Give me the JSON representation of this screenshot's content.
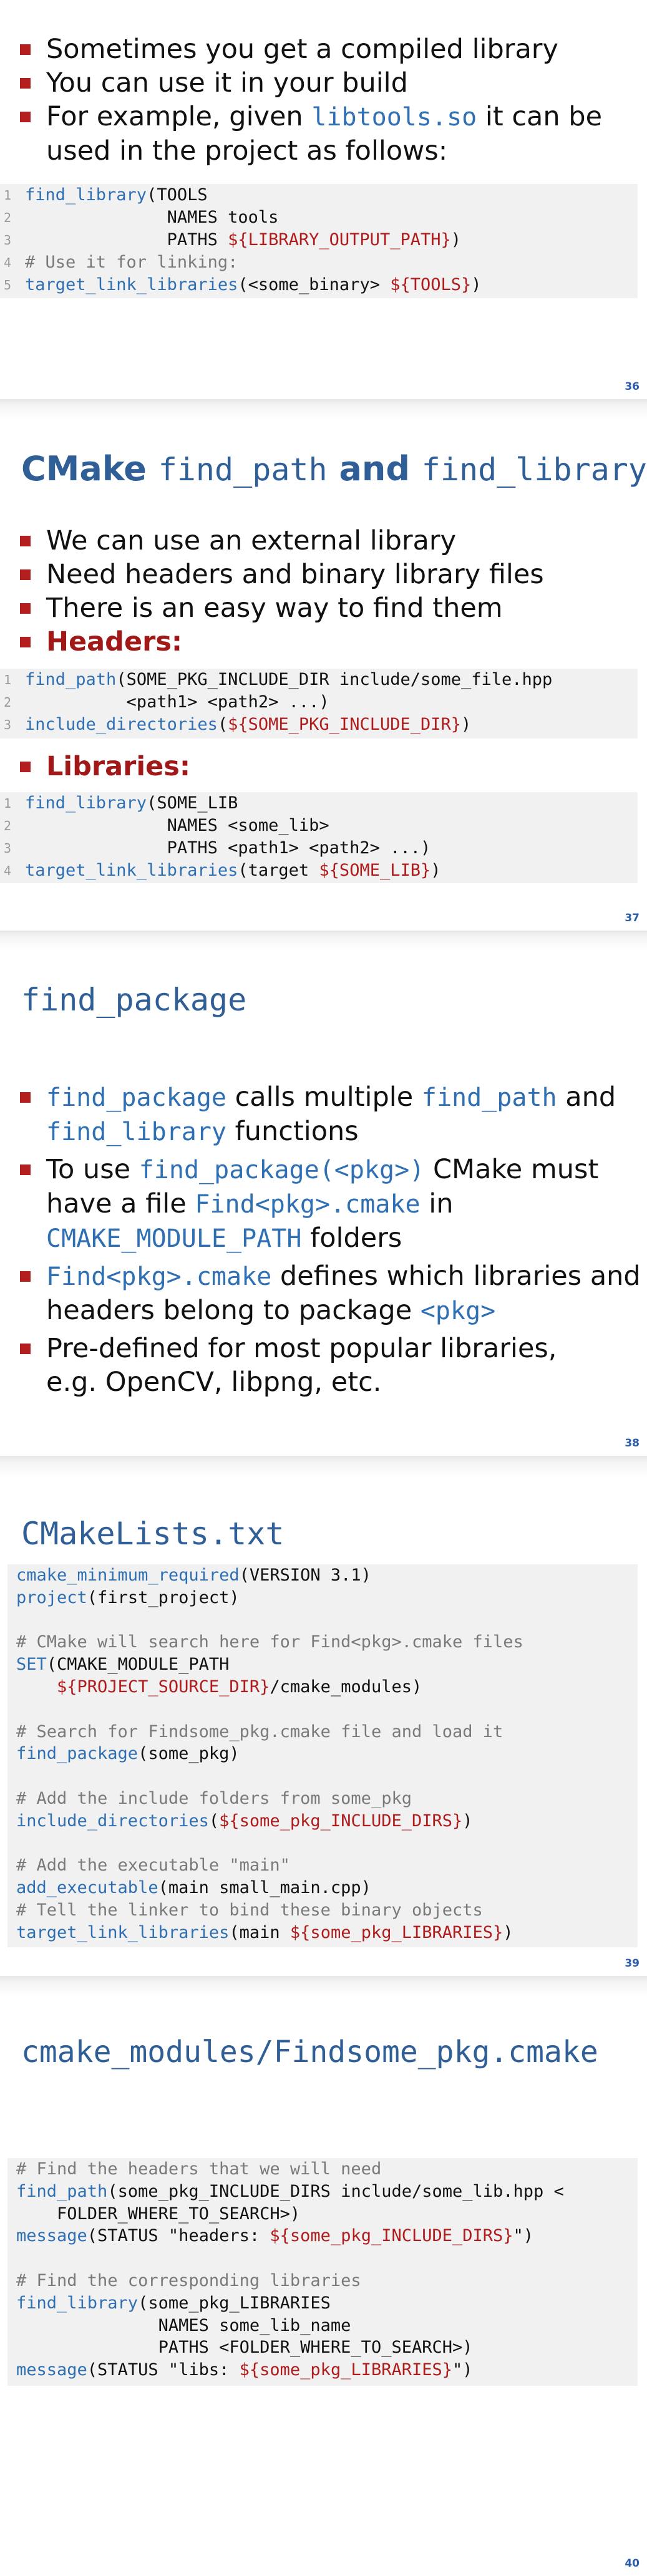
{
  "slide36": {
    "bullets": [
      "Sometimes you get a compiled library",
      "You can use it in your build"
    ],
    "bullet3_before": "For example, given ",
    "bullet3_code": "libtools.so",
    "bullet3_after": " it can be",
    "bullet3_line2": "used in the project as follows:",
    "code": {
      "l1_fn": "find_library",
      "l1_rest": "(TOOLS",
      "l2": "              NAMES tools",
      "l3_pre": "              PATHS ",
      "l3_var": "${LIBRARY_OUTPUT_PATH}",
      "l3_post": ")",
      "l4": "# Use it for linking:",
      "l5_fn": "target_link_libraries",
      "l5_rest": "(<some_binary> ",
      "l5_var": "${TOOLS}",
      "l5_post": ")"
    },
    "page_number": "36"
  },
  "slide37": {
    "title_prefix": "CMake ",
    "title_code1": "find_path",
    "title_mid": " and ",
    "title_code2": "find_library",
    "bullets": [
      "We can use an external library",
      "Need headers and binary library files",
      "There is an easy way to find them"
    ],
    "headers_label": "Headers:",
    "code1": {
      "l1_fn": "find_path",
      "l1_rest": "(SOME_PKG_INCLUDE_DIR include/some_file.hpp",
      "l2": "          <path1> <path2> ...)",
      "l3_fn": "include_directories",
      "l3_pre": "(",
      "l3_var": "${SOME_PKG_INCLUDE_DIR}",
      "l3_post": ")"
    },
    "libraries_label": "Libraries:",
    "code2": {
      "l1_fn": "find_library",
      "l1_rest": "(SOME_LIB",
      "l2": "              NAMES <some_lib>",
      "l3": "              PATHS <path1> <path2> ...)",
      "l4_fn": "target_link_libraries",
      "l4_rest": "(target ",
      "l4_var": "${SOME_LIB}",
      "l4_post": ")"
    },
    "page_number": "37"
  },
  "slide38": {
    "title": "find_package",
    "b1_code1": "find_package",
    "b1_text1": " calls multiple ",
    "b1_code2": "find_path",
    "b1_text2": " and",
    "b1_code3": "find_library",
    "b1_text3": " functions",
    "b2_text1": "To use ",
    "b2_code1": "find_package(<pkg>)",
    "b2_text2": " CMake must",
    "b2_text3": "have a file ",
    "b2_code2": "Find<pkg>.cmake",
    "b2_text4": " in",
    "b2_code3": "CMAKE_MODULE_PATH",
    "b2_text5": " folders",
    "b3_code1": "Find<pkg>.cmake",
    "b3_text1": " defines which libraries and",
    "b3_text2": "headers belong to package ",
    "b3_code2": "<pkg>",
    "b4_line1": "Pre-defined for most popular libraries,",
    "b4_line2": "e.g. OpenCV, libpng, etc.",
    "page_number": "38"
  },
  "slide39": {
    "title": "CMakeLists.txt",
    "lines": [
      {
        "fn": "cmake_minimum_required",
        "rest": "(VERSION 3.1)"
      },
      {
        "fn": "project",
        "rest": "(first_project)"
      },
      {
        "text": ""
      },
      {
        "cmt": "# CMake will search here for Find<pkg>.cmake files"
      },
      {
        "fn": "SET",
        "rest": "(CMAKE_MODULE_PATH"
      },
      {
        "pre": "    ",
        "var": "${PROJECT_SOURCE_DIR}",
        "post": "/cmake_modules)"
      },
      {
        "text": ""
      },
      {
        "cmt": "# Search for Findsome_pkg.cmake file and load it"
      },
      {
        "fn": "find_package",
        "rest": "(some_pkg)"
      },
      {
        "text": ""
      },
      {
        "cmt": "# Add the include folders from some_pkg"
      },
      {
        "fn": "include_directories",
        "rest": "(",
        "var": "${some_pkg_INCLUDE_DIRS}",
        "post": ")"
      },
      {
        "text": ""
      },
      {
        "cmt": "# Add the executable \"main\""
      },
      {
        "fn": "add_executable",
        "rest": "(main small_main.cpp)"
      },
      {
        "cmt": "# Tell the linker to bind these binary objects"
      },
      {
        "fn": "target_link_libraries",
        "rest": "(main ",
        "var": "${some_pkg_LIBRARIES}",
        "post": ")"
      }
    ],
    "page_number": "39"
  },
  "slide40": {
    "title": "cmake_modules/Findsome_pkg.cmake",
    "lines": [
      {
        "cmt": "# Find the headers that we will need"
      },
      {
        "fn": "find_path",
        "rest": "(some_pkg_INCLUDE_DIRS include/some_lib.hpp <"
      },
      {
        "text": "    FOLDER_WHERE_TO_SEARCH>)"
      },
      {
        "fn": "message",
        "rest": "(STATUS \"headers: ",
        "var": "${some_pkg_INCLUDE_DIRS}",
        "post": "\")"
      },
      {
        "text": ""
      },
      {
        "cmt": "# Find the corresponding libraries"
      },
      {
        "fn": "find_library",
        "rest": "(some_pkg_LIBRARIES"
      },
      {
        "text": "              NAMES some_lib_name"
      },
      {
        "text": "              PATHS <FOLDER_WHERE_TO_SEARCH>)"
      },
      {
        "fn": "message",
        "rest": "(STATUS \"libs: ",
        "var": "${some_pkg_LIBRARIES}",
        "post": "\")"
      }
    ],
    "page_number": "40"
  }
}
